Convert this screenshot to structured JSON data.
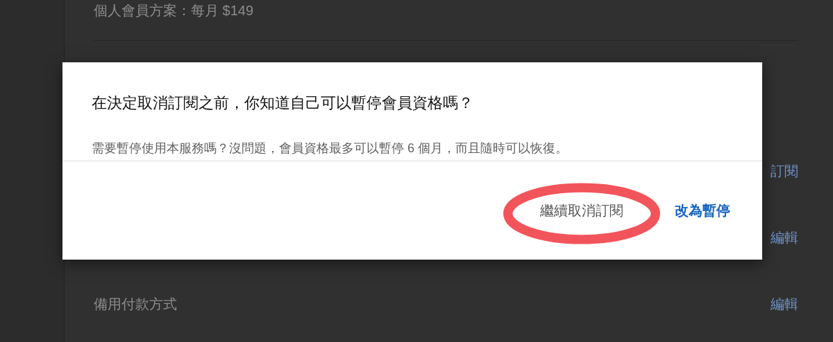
{
  "page": {
    "plan_text": "個人會員方案：每月 $149",
    "rows": [
      {
        "label": "",
        "link": "訂閱"
      },
      {
        "label": "",
        "link": "編輯"
      },
      {
        "label": "備用付款方式",
        "link": "編輯"
      }
    ]
  },
  "dialog": {
    "title": "在決定取消訂閱之前，你知道自己可以暫停會員資格嗎？",
    "body": "需要暫停使用本服務嗎？沒問題，會員資格最多可以暫停 6 個月，而且隨時可以恢復。",
    "buttons": [
      {
        "label": "繼續取消訂閱",
        "kind": "secondary",
        "highlighted": true
      },
      {
        "label": "改為暫停",
        "kind": "primary",
        "highlighted": false
      }
    ]
  }
}
